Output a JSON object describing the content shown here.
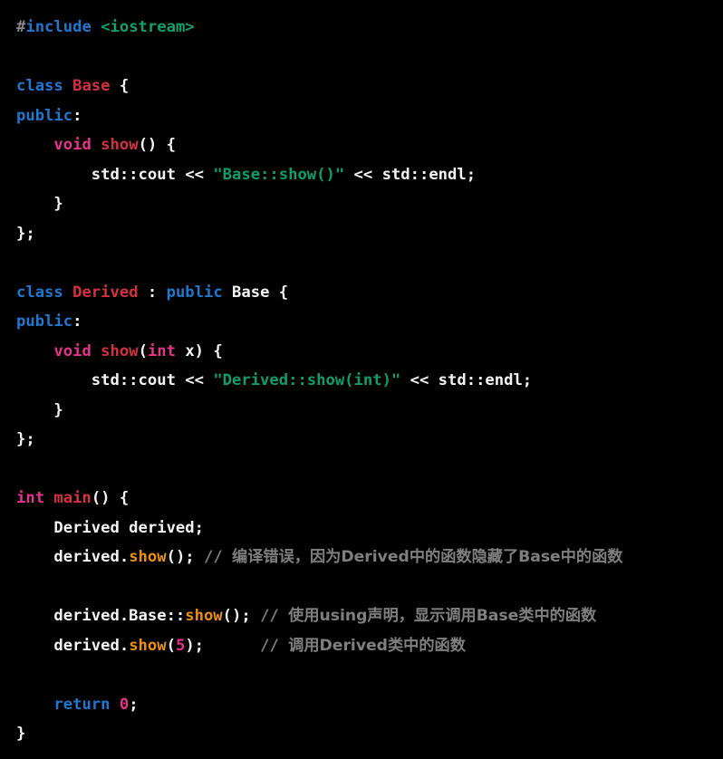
{
  "document": {
    "kind": "source-code",
    "language": "C++",
    "theme": {
      "background": "#000000",
      "foreground": "#f4f4f4",
      "keyword": "#2077cf",
      "type": "#e5338b",
      "class_name": "#d4313f",
      "function_def": "#d4313f",
      "function_call": "#eb9012",
      "string": "#0f9d6e",
      "header_include": "#11a06d",
      "number": "#e5338b",
      "comment": "#7f7f7f",
      "preprocessor_hash": "#8a8a8a"
    }
  },
  "code": {
    "lines": [
      {
        "n": 1,
        "text": "#include <iostream>",
        "tokens": [
          {
            "t": "#",
            "c": "hash"
          },
          {
            "t": "include",
            "c": "kw"
          },
          {
            "t": " ",
            "c": "plain"
          },
          {
            "t": "<iostream>",
            "c": "header"
          }
        ]
      },
      {
        "n": 2,
        "text": "",
        "tokens": []
      },
      {
        "n": 3,
        "text": "class Base {",
        "tokens": [
          {
            "t": "class",
            "c": "kw"
          },
          {
            "t": " ",
            "c": "plain"
          },
          {
            "t": "Base",
            "c": "class"
          },
          {
            "t": " {",
            "c": "plain"
          }
        ]
      },
      {
        "n": 4,
        "text": "public:",
        "tokens": [
          {
            "t": "public",
            "c": "kw"
          },
          {
            "t": ":",
            "c": "plain"
          }
        ]
      },
      {
        "n": 5,
        "text": "    void show() {",
        "tokens": [
          {
            "t": "    ",
            "c": "plain"
          },
          {
            "t": "void",
            "c": "type"
          },
          {
            "t": " ",
            "c": "plain"
          },
          {
            "t": "show",
            "c": "fn"
          },
          {
            "t": "() {",
            "c": "plain"
          }
        ]
      },
      {
        "n": 6,
        "text": "        std::cout << \"Base::show()\" << std::endl;",
        "tokens": [
          {
            "t": "        std::cout << ",
            "c": "plain"
          },
          {
            "t": "\"Base::show()\"",
            "c": "string"
          },
          {
            "t": " << std::endl;",
            "c": "plain"
          }
        ]
      },
      {
        "n": 7,
        "text": "    }",
        "tokens": [
          {
            "t": "    }",
            "c": "plain"
          }
        ]
      },
      {
        "n": 8,
        "text": "};",
        "tokens": [
          {
            "t": "};",
            "c": "plain"
          }
        ]
      },
      {
        "n": 9,
        "text": "",
        "tokens": []
      },
      {
        "n": 10,
        "text": "class Derived : public Base {",
        "tokens": [
          {
            "t": "class",
            "c": "kw"
          },
          {
            "t": " ",
            "c": "plain"
          },
          {
            "t": "Derived",
            "c": "class"
          },
          {
            "t": " : ",
            "c": "plain"
          },
          {
            "t": "public",
            "c": "kw"
          },
          {
            "t": " Base {",
            "c": "plain"
          }
        ]
      },
      {
        "n": 11,
        "text": "public:",
        "tokens": [
          {
            "t": "public",
            "c": "kw"
          },
          {
            "t": ":",
            "c": "plain"
          }
        ]
      },
      {
        "n": 12,
        "text": "    void show(int x) {",
        "tokens": [
          {
            "t": "    ",
            "c": "plain"
          },
          {
            "t": "void",
            "c": "type"
          },
          {
            "t": " ",
            "c": "plain"
          },
          {
            "t": "show",
            "c": "fn"
          },
          {
            "t": "(",
            "c": "plain"
          },
          {
            "t": "int",
            "c": "type"
          },
          {
            "t": " x) {",
            "c": "plain"
          }
        ]
      },
      {
        "n": 13,
        "text": "        std::cout << \"Derived::show(int)\" << std::endl;",
        "tokens": [
          {
            "t": "        std::cout << ",
            "c": "plain"
          },
          {
            "t": "\"Derived::show(int)\"",
            "c": "string"
          },
          {
            "t": " << std::endl;",
            "c": "plain"
          }
        ]
      },
      {
        "n": 14,
        "text": "    }",
        "tokens": [
          {
            "t": "    }",
            "c": "plain"
          }
        ]
      },
      {
        "n": 15,
        "text": "};",
        "tokens": [
          {
            "t": "};",
            "c": "plain"
          }
        ]
      },
      {
        "n": 16,
        "text": "",
        "tokens": []
      },
      {
        "n": 17,
        "text": "int main() {",
        "tokens": [
          {
            "t": "int",
            "c": "type"
          },
          {
            "t": " ",
            "c": "plain"
          },
          {
            "t": "main",
            "c": "fn"
          },
          {
            "t": "() {",
            "c": "plain"
          }
        ]
      },
      {
        "n": 18,
        "text": "    Derived derived;",
        "tokens": [
          {
            "t": "    Derived derived;",
            "c": "plain"
          }
        ]
      },
      {
        "n": 19,
        "text": "    derived.show(); // 编译错误，因为Derived中的函数隐藏了Base中的函数",
        "tokens": [
          {
            "t": "    derived.",
            "c": "plain"
          },
          {
            "t": "show",
            "c": "fn-call"
          },
          {
            "t": "(); ",
            "c": "plain"
          },
          {
            "t": "// ",
            "c": "comment"
          },
          {
            "t": "编译错误，因为Derived中的函数隐藏了Base中的函数",
            "c": "comment-cn"
          }
        ]
      },
      {
        "n": 20,
        "text": "",
        "tokens": []
      },
      {
        "n": 21,
        "text": "    derived.Base::show(); // 使用using声明，显示调用Base类中的函数",
        "tokens": [
          {
            "t": "    derived.Base::",
            "c": "plain"
          },
          {
            "t": "show",
            "c": "fn-call"
          },
          {
            "t": "(); ",
            "c": "plain"
          },
          {
            "t": "// ",
            "c": "comment"
          },
          {
            "t": "使用using声明，显示调用Base类中的函数",
            "c": "comment-cn"
          }
        ]
      },
      {
        "n": 22,
        "text": "    derived.show(5);      // 调用Derived类中的函数",
        "tokens": [
          {
            "t": "    derived.",
            "c": "plain"
          },
          {
            "t": "show",
            "c": "fn-call"
          },
          {
            "t": "(",
            "c": "plain"
          },
          {
            "t": "5",
            "c": "num"
          },
          {
            "t": ");      ",
            "c": "plain"
          },
          {
            "t": "// ",
            "c": "comment"
          },
          {
            "t": "调用Derived类中的函数",
            "c": "comment-cn"
          }
        ]
      },
      {
        "n": 23,
        "text": "",
        "tokens": []
      },
      {
        "n": 24,
        "text": "    return 0;",
        "tokens": [
          {
            "t": "    ",
            "c": "plain"
          },
          {
            "t": "return",
            "c": "kw"
          },
          {
            "t": " ",
            "c": "plain"
          },
          {
            "t": "0",
            "c": "num"
          },
          {
            "t": ";",
            "c": "plain"
          }
        ]
      },
      {
        "n": 25,
        "text": "}",
        "tokens": [
          {
            "t": "}",
            "c": "plain"
          }
        ]
      }
    ]
  }
}
